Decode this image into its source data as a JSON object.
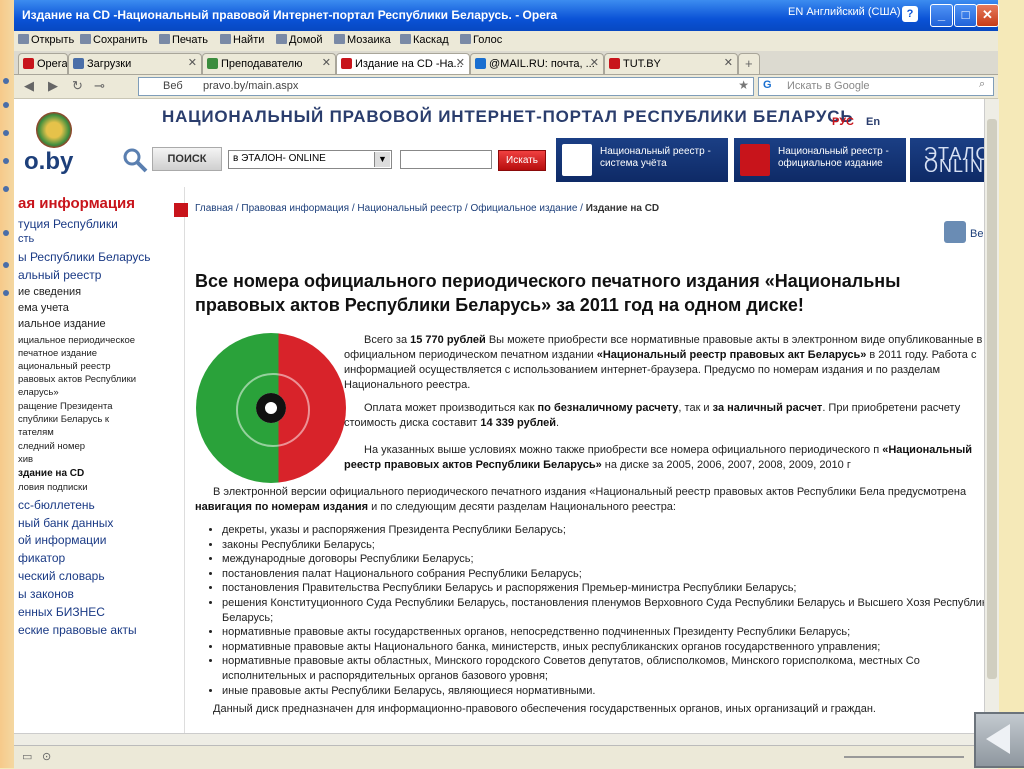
{
  "window": {
    "title": "Издание на CD -Национальный правовой Интернет-портал Республики Беларусь. - Opera",
    "lang_indicator": "EN Английский (США)",
    "buttons": {
      "help": "?",
      "minimize": "_",
      "maximize": "□",
      "close": "✕"
    }
  },
  "menu": [
    "Открыть",
    "Сохранить",
    "Печать",
    "Найти",
    "Домой",
    "Мозаика",
    "Каскад",
    "Голос"
  ],
  "tabs": [
    {
      "label": "Opera",
      "active": false,
      "color": "#c8141b"
    },
    {
      "label": "Загрузки",
      "active": false,
      "color": "#4a6ea8"
    },
    {
      "label": "Преподавателю",
      "active": false,
      "color": "#3b8c3e"
    },
    {
      "label": "Издание на CD -На...",
      "active": true,
      "color": "#c8141b"
    },
    {
      "label": "@MAIL.RU: почта, ...",
      "active": false,
      "color": "#1a6fd0"
    },
    {
      "label": "TUT.BY",
      "active": false,
      "color": "#c8141b"
    },
    {
      "label": "+",
      "active": false,
      "color": "#999999"
    }
  ],
  "address": {
    "mode": "Веб",
    "url": "pravo.by/main.aspx",
    "search_placeholder": "Искать в Google"
  },
  "site": {
    "logo_text": "o.by",
    "title": "НАЦИОНАЛЬНЫЙ ПРАВОВОЙ ИНТЕРНЕТ-ПОРТАЛ РЕСПУБЛИКИ БЕЛАРУСЬ",
    "lang_rus": "РУС",
    "lang_en": "En",
    "search_label": "ПОИСК",
    "search_select": "в ЭТАЛОН- ONLINE",
    "search_button": "Искать",
    "banner1": "Национальный реестр -\nсистема учёта",
    "banner2": "Национальный реестр -\nофициальное издание",
    "banner3": "ЭТАЛОН ONLINE"
  },
  "sidebar": {
    "heading": "ая информация",
    "items": [
      "туция Республики",
      "сть",
      "ы Республики Беларусь",
      "альный реестр",
      "ие сведения",
      "ема учета",
      "иальное издание",
      "ициальное периодическое",
      "печатное издание",
      "ациональный реестр",
      "равовых актов Республики",
      "еларусь»",
      "ращение Президента",
      "спублики Беларусь к",
      "тателям",
      "следний номер",
      "хив",
      "здание на CD",
      "ловия подписки",
      "сс-бюллетень",
      "ный банк данных",
      "ой информации",
      "фикатор",
      "ческий словарь",
      "ы законов",
      "енных БИЗНЕС",
      "еские правовые акты"
    ]
  },
  "breadcrumb": {
    "parts": [
      "Главная",
      "Правовая информация",
      "Национальный реестр",
      "Официальное издание"
    ],
    "current": "Издание на CD",
    "sep": " / "
  },
  "print_label": "Ве",
  "heading": "Все номера официального периодического печатного издания «Национальны правовых актов Республики Беларусь» за 2011 год на одном диске!",
  "para1": {
    "t1": "Всего за ",
    "price": "15 770 рублей",
    "t2": " Вы можете приобрести все нормативные правовые акты в электронном виде опубликованные в официальном периодическом печатном издании ",
    "name": "«Национальный реестр правовых акт Беларусь»",
    "t3": " в 2011 году. Работа с информацией осуществляется с использованием интернет-браузера. Предусмо по номерам издания и по разделам Национального реестра."
  },
  "para2": {
    "t1": "Оплата может производиться как ",
    "b1": "по безналичному расчету",
    "t2": ", так и ",
    "b2": "за наличный расчет",
    "t3": ". При приобретени расчету стоимость диска составит ",
    "b3": "14 339 рублей",
    "t4": "."
  },
  "para3": {
    "t1": "На указанных выше условиях можно также приобрести все номера официального периодического п ",
    "b1": "«Национальный реестр правовых актов Республики Беларусь»",
    "t2": " на диске за 2005, 2006, 2007, 2008, 2009, 2010 г"
  },
  "para4": {
    "t1": "В электронной версии официального периодического печатного издания «Национальный реестр правовых актов Республики Бела предусмотрена ",
    "b1": "навигация по номерам издания",
    "t2": " и по следующим десяти разделам Национального реестра:"
  },
  "bullets": [
    "декреты, указы и распоряжения Президента Республики Беларусь;",
    "законы Республики Беларусь;",
    "международные договоры Республики Беларусь;",
    "постановления палат Национального собрания Республики Беларусь;",
    "постановления Правительства Республики Беларусь и распоряжения Премьер-министра Республики Беларусь;",
    "решения Конституционного Суда Республики Беларусь, постановления пленумов Верховного Суда Республики Беларусь и Высшего Хозя Республики Беларусь;",
    "нормативные правовые акты государственных органов, непосредственно подчиненных Президенту Республики Беларусь;",
    "нормативные правовые акты Национального банка, министерств, иных республиканских органов государственного управления;",
    "нормативные правовые акты областных, Минского городского Советов депутатов, облисполкомов, Минского горисполкома, местных Со исполнительных и распорядительных органов базового уровня;",
    "иные правовые акты Республики Беларусь, являющиеся нормативными."
  ],
  "footer_note": "Данный диск предназначен для информационно-правового обеспечения государственных органов, иных организаций и граждан."
}
